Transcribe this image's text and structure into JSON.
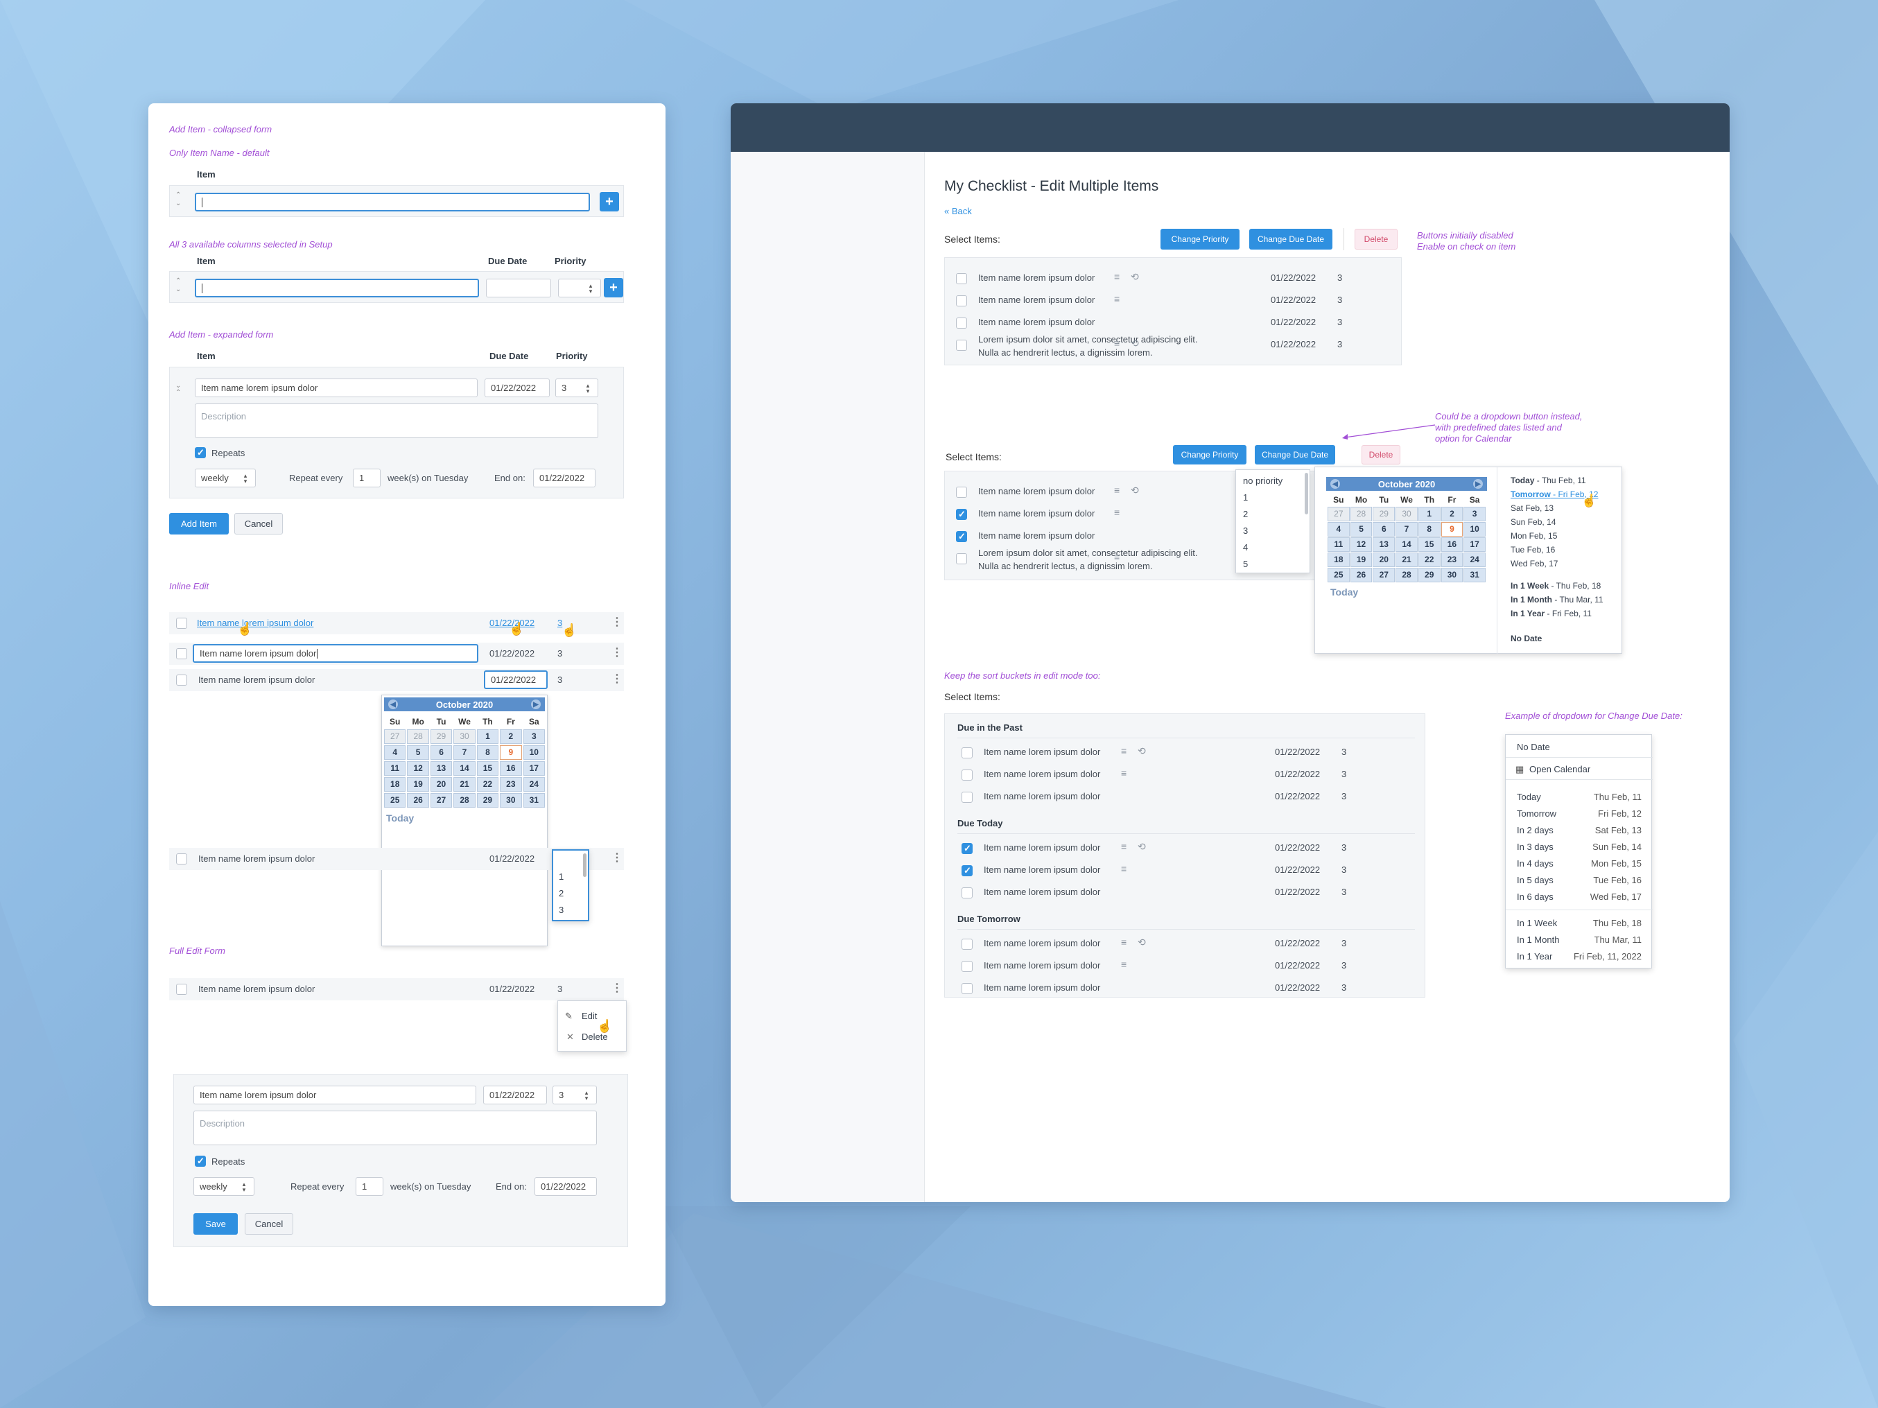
{
  "left": {
    "notes": {
      "collapsed": "Add Item - collapsed form",
      "default": "Only Item Name - default",
      "all3": "All 3 available columns selected in Setup",
      "expanded": "Add Item - expanded form",
      "inline": "Inline Edit",
      "full": "Full Edit Form"
    },
    "col_item": "Item",
    "col_due": "Due Date",
    "col_priority": "Priority",
    "item_name": "Item name lorem ipsum dolor",
    "date": "01/22/2022",
    "priority": "3",
    "desc_placeholder": "Description",
    "repeats": "Repeats",
    "freq": "weekly",
    "repeat_every": "Repeat every",
    "repeat_n": "1",
    "repeat_suffix": "week(s) on Tuesday",
    "end_on": "End on:",
    "add_item": "Add Item",
    "cancel": "Cancel",
    "save": "Save",
    "plus": "+",
    "priority_opts": [
      "1",
      "2",
      "3"
    ],
    "ctx_edit": "Edit",
    "ctx_delete": "Delete"
  },
  "calendar": {
    "title": "October 2020",
    "dows": [
      "Su",
      "Mo",
      "Tu",
      "We",
      "Th",
      "Fr",
      "Sa"
    ],
    "days": [
      "27",
      "28",
      "29",
      "30",
      "1",
      "2",
      "3",
      "4",
      "5",
      "6",
      "7",
      "8",
      "9",
      "10",
      "11",
      "12",
      "13",
      "14",
      "15",
      "16",
      "17",
      "18",
      "19",
      "20",
      "21",
      "22",
      "23",
      "24",
      "25",
      "26",
      "27",
      "28",
      "29",
      "30",
      "31"
    ],
    "today": "Today"
  },
  "right": {
    "title": "My Checklist - Edit Multiple Items",
    "back": "« Back",
    "select_items": "Select Items:",
    "change_priority": "Change Priority",
    "change_due": "Change Due Date",
    "delete": "Delete",
    "note_disabled_1": "Buttons initially disabled",
    "note_disabled_2": "Enable on check on item",
    "note_dropdown_1": "Could be a dropdown button instead,",
    "note_dropdown_2": "with predefined dates listed and",
    "note_dropdown_3": "option for Calendar",
    "note_buckets": "Keep the sort buckets in edit mode too:",
    "note_example": "Example of dropdown for Change Due Date:",
    "item_name": "Item name lorem ipsum dolor",
    "long_1": "Lorem ipsum dolor sit amet, consectetur adipiscing elit.",
    "long_2": "Nulla ac hendrerit lectus, a dignissim lorem.",
    "date": "01/22/2022",
    "priority": "3",
    "priority_opts": [
      "no priority",
      "1",
      "2",
      "3",
      "4",
      "5"
    ],
    "quick": [
      {
        "b": "Today",
        "r": " - Thu Feb, 11"
      },
      {
        "b": "Tomorrow",
        "r": " - Fri Feb, 12"
      },
      {
        "b": "",
        "r": "Sat Feb, 13"
      },
      {
        "b": "",
        "r": "Sun Feb, 14"
      },
      {
        "b": "",
        "r": "Mon Feb, 15"
      },
      {
        "b": "",
        "r": "Tue Feb, 16"
      },
      {
        "b": "",
        "r": "Wed Feb, 17"
      },
      {
        "b": "In 1 Week",
        "r": " - Thu Feb, 18"
      },
      {
        "b": "In 1 Month",
        "r": " - Thu Mar, 11"
      },
      {
        "b": "In 1 Year",
        "r": " - Fri Feb, 11"
      },
      {
        "b": "No Date",
        "r": ""
      }
    ],
    "buckets": [
      "Due in the Past",
      "Due Today",
      "Due Tomorrow"
    ],
    "example": {
      "no_date": "No Date",
      "open_calendar": "Open Calendar",
      "rows": [
        [
          "Today",
          "Thu Feb, 11"
        ],
        [
          "Tomorrow",
          "Fri Feb, 12"
        ],
        [
          "In 2 days",
          "Sat Feb, 13"
        ],
        [
          "In 3 days",
          "Sun Feb, 14"
        ],
        [
          "In 4 days",
          "Mon Feb, 15"
        ],
        [
          "In 5 days",
          "Tue Feb, 16"
        ],
        [
          "In 6 days",
          "Wed Feb, 17"
        ],
        [
          "In 1 Week",
          "Thu Feb, 18"
        ],
        [
          "In 1 Month",
          "Thu Mar, 11"
        ],
        [
          "In 1 Year",
          "Fri Feb, 11, 2022"
        ]
      ]
    }
  }
}
